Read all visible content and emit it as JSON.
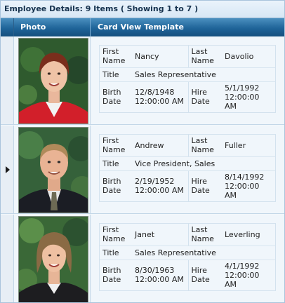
{
  "grid": {
    "caption": "Employee Details: 9 Items ( Showing 1 to 7 )",
    "columns": {
      "photo": "Photo",
      "card": "Card View Template"
    },
    "labels": {
      "first_name": "First Name",
      "last_name": "Last Name",
      "title": "Title",
      "birth_date": "Birth Date",
      "hire_date": "Hire Date"
    },
    "rows": [
      {
        "first_name": "Nancy",
        "last_name": "Davolio",
        "title": "Sales Representative",
        "birth_date": "12/8/1948 12:00:00 AM",
        "hire_date": "5/1/1992 12:00:00 AM",
        "selected": false
      },
      {
        "first_name": "Andrew",
        "last_name": "Fuller",
        "title": "Vice President, Sales",
        "birth_date": "2/19/1952 12:00:00 AM",
        "hire_date": "8/14/1992 12:00:00 AM",
        "selected": true
      },
      {
        "first_name": "Janet",
        "last_name": "Leverling",
        "title": "Sales Representative",
        "birth_date": "8/30/1963 12:00:00 AM",
        "hire_date": "4/1/1992 12:00:00 AM",
        "selected": false
      }
    ]
  },
  "colors": {
    "header": "#1f6499",
    "caption_bg": "#d7e7f5",
    "row_bg": "#f0f6fb",
    "border": "#c3d7e8"
  }
}
